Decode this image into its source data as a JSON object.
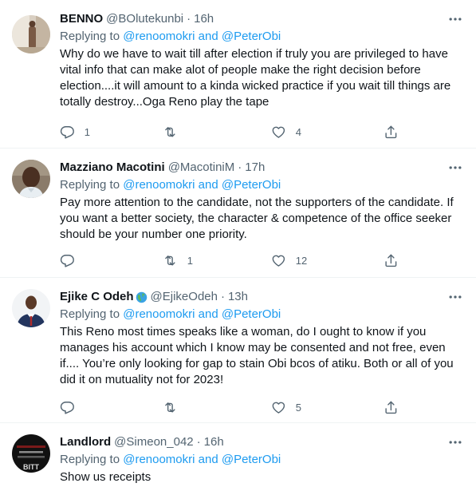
{
  "tweets": [
    {
      "name": "BENNO",
      "handle": "@BOlutekunbi",
      "time": "16h",
      "replying_prefix": "Replying to ",
      "mention_text": "@renoomokri and @PeterObi",
      "text": "Why do we have to wait till after election if truly you are privileged to have\nvital info that can make alot of people make the right decision before\nelection....it will amount to a kinda wicked practice if you wait till things are\ntotally destroy...Oga Reno play the tape",
      "reply_count": "1",
      "retweet_count": "",
      "like_count": "4"
    },
    {
      "name": "Mazziano Macotini",
      "handle": "@MacotiniM",
      "time": "17h",
      "replying_prefix": "Replying to ",
      "mention_text": "@renoomokri and @PeterObi",
      "text": "Pay more attention to the candidate, not the supporters of the candidate. If\nyou want a better society, the character & competence of the office seeker\nshould be your number one priority.",
      "reply_count": "",
      "retweet_count": "1",
      "like_count": "12"
    },
    {
      "name": "Ejike C Odeh",
      "handle": "@EjikeOdeh",
      "time": "13h",
      "replying_prefix": "Replying to ",
      "mention_text": "@renoomokri and @PeterObi",
      "text": "This Reno most times speaks like a woman, do I ought to know if you\nmanages his account which I know may be consented and not free, even\nif.... You’re only looking for gap to stain Obi bcos of atiku. Both or all of you\ndid it on mutuality not for 2023!",
      "reply_count": "",
      "retweet_count": "",
      "like_count": "5"
    },
    {
      "name": "Landlord",
      "handle": "@Simeon_042",
      "time": "16h",
      "replying_prefix": "Replying to ",
      "mention_text": "@renoomokri and @PeterObi",
      "text": "Show us receipts",
      "avatar_text": "BITT"
    }
  ],
  "icons": {
    "more": "more-horizontal-icon",
    "reply": "reply-icon",
    "retweet": "retweet-icon",
    "like": "heart-icon",
    "share": "share-icon",
    "badge": "globe-emoji-icon"
  },
  "colors": {
    "link": "#1d9bf0",
    "secondary_text": "#536471",
    "primary_text": "#0f1419",
    "divider": "#eff3f4"
  }
}
